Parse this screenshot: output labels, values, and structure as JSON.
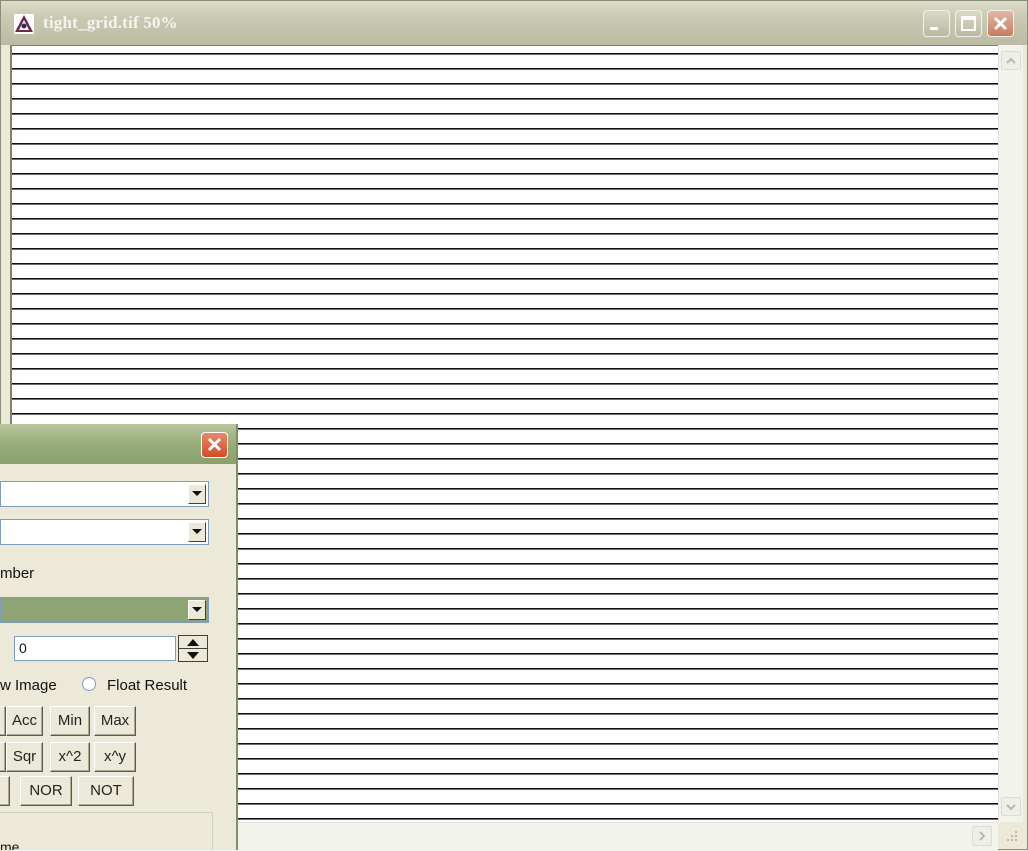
{
  "main_window": {
    "title": "tight_grid.tif 50%"
  },
  "calculator": {
    "number_label_partial": "mber",
    "number_value": "0",
    "new_image_label_partial": "w Image",
    "float_result_label": "Float Result",
    "button_rows": [
      [
        "Acc",
        "Min",
        "Max"
      ],
      [
        "Sqr",
        "x^2",
        "x^y"
      ],
      [
        "NOR",
        "NOT"
      ]
    ],
    "bottom_partial_text": "me"
  },
  "colors": {
    "title_green": "#8fa474",
    "close_red": "#d24b26"
  }
}
